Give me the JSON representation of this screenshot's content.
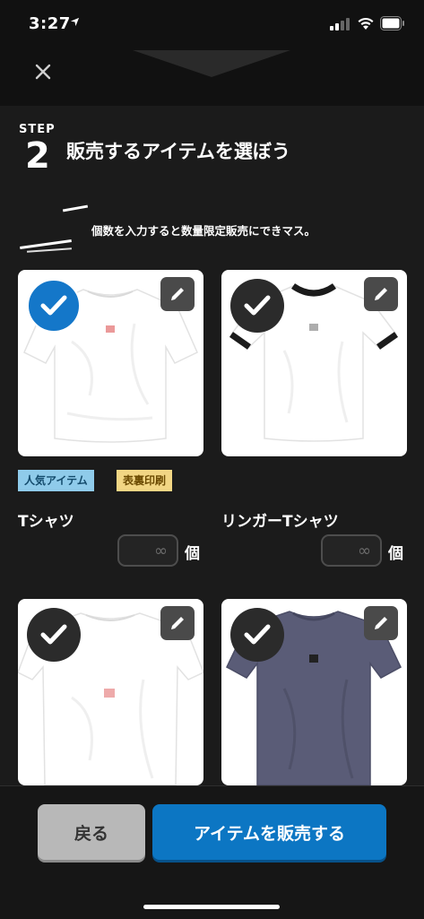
{
  "status_bar": {
    "time": "3:27"
  },
  "step": {
    "label": "STEP",
    "number": "2",
    "title": "販売するアイテムを選ぼう"
  },
  "subtitle": "個数を入力すると数量限定販売にできマス。",
  "tags": {
    "popular": "人気アイテム",
    "both_sides": "表裏印刷"
  },
  "items": [
    {
      "name": "Tシャツ",
      "selected": true,
      "qty_placeholder": "∞",
      "unit": "個",
      "shirt_color": "#ffffff"
    },
    {
      "name": "リンガーTシャツ",
      "selected": false,
      "qty_placeholder": "∞",
      "unit": "個",
      "shirt_color": "#ffffff",
      "trim_color": "#1b1b1b"
    },
    {
      "name": "",
      "selected": false,
      "shirt_color": "#ffffff"
    },
    {
      "name": "",
      "selected": false,
      "shirt_color": "#5a5c77"
    }
  ],
  "buttons": {
    "back": "戻る",
    "sell": "アイテムを販売する"
  },
  "colors": {
    "accent": "#0c76c3",
    "background": "#1b1b1b",
    "check_selected": "#1477c9"
  }
}
